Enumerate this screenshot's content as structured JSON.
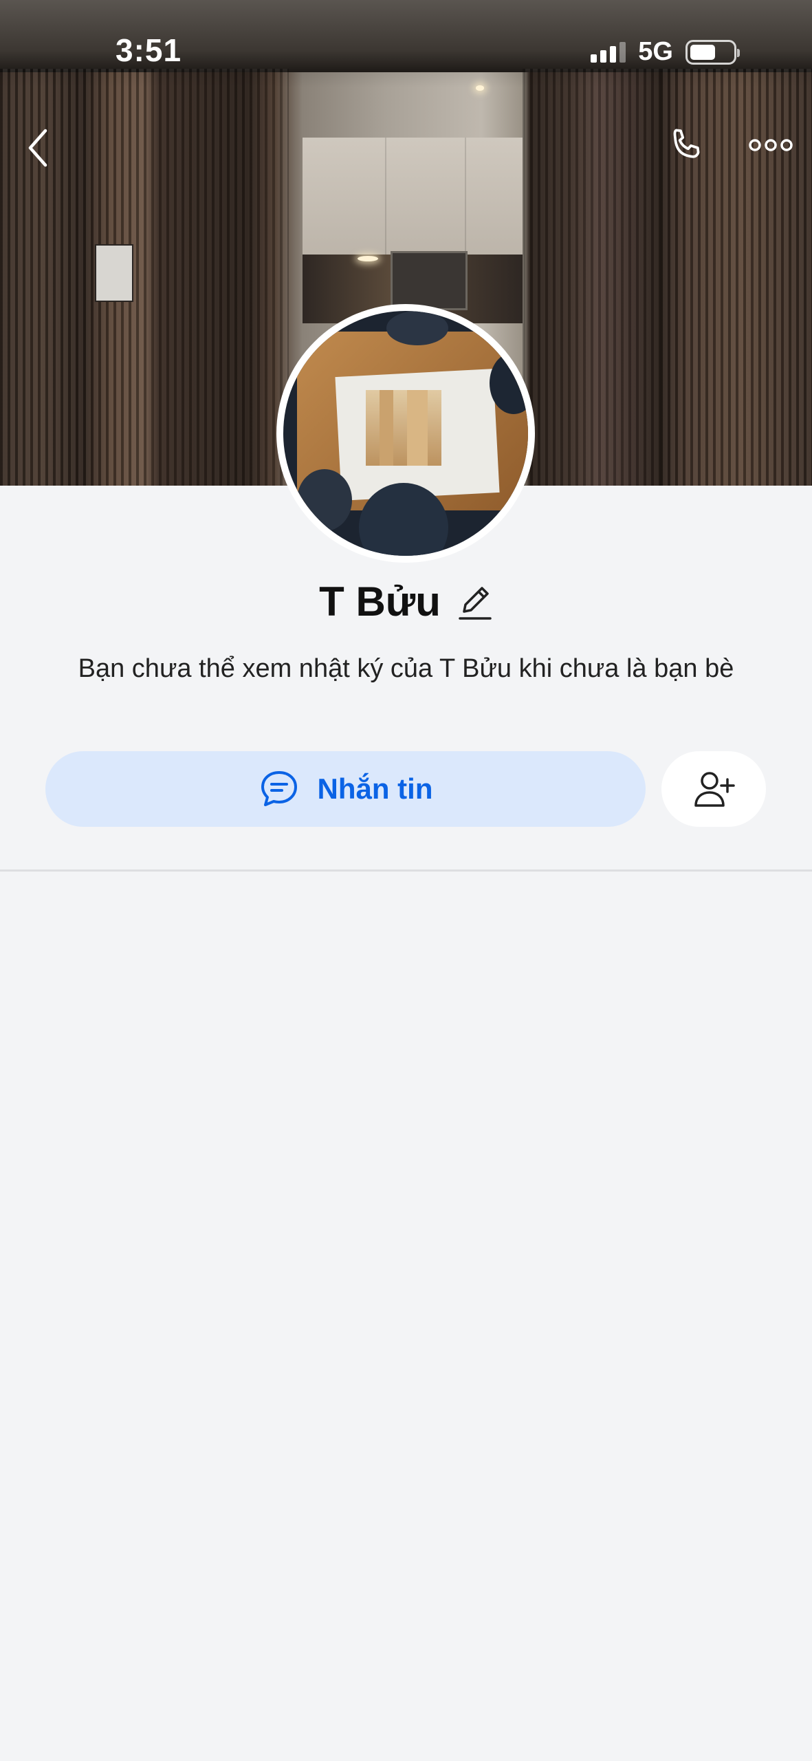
{
  "status_bar": {
    "time": "3:51",
    "network": "5G",
    "signal_bars": 3,
    "battery_level": 0.6
  },
  "header": {
    "back_icon": "chevron-left-icon",
    "call_icon": "phone-icon",
    "more_icon": "more-horizontal-icon"
  },
  "profile": {
    "name": "T Bửu",
    "edit_icon": "pencil-icon",
    "diary_message": "Bạn chưa thể xem nhật ký của T Bửu khi chưa là bạn bè"
  },
  "actions": {
    "message_label": "Nhắn tin",
    "message_icon": "chat-bubble-icon",
    "add_friend_icon": "add-user-icon"
  },
  "colors": {
    "accent": "#0b63e5",
    "message_button_bg": "#dbe8fc",
    "page_bg": "#f3f4f6"
  }
}
